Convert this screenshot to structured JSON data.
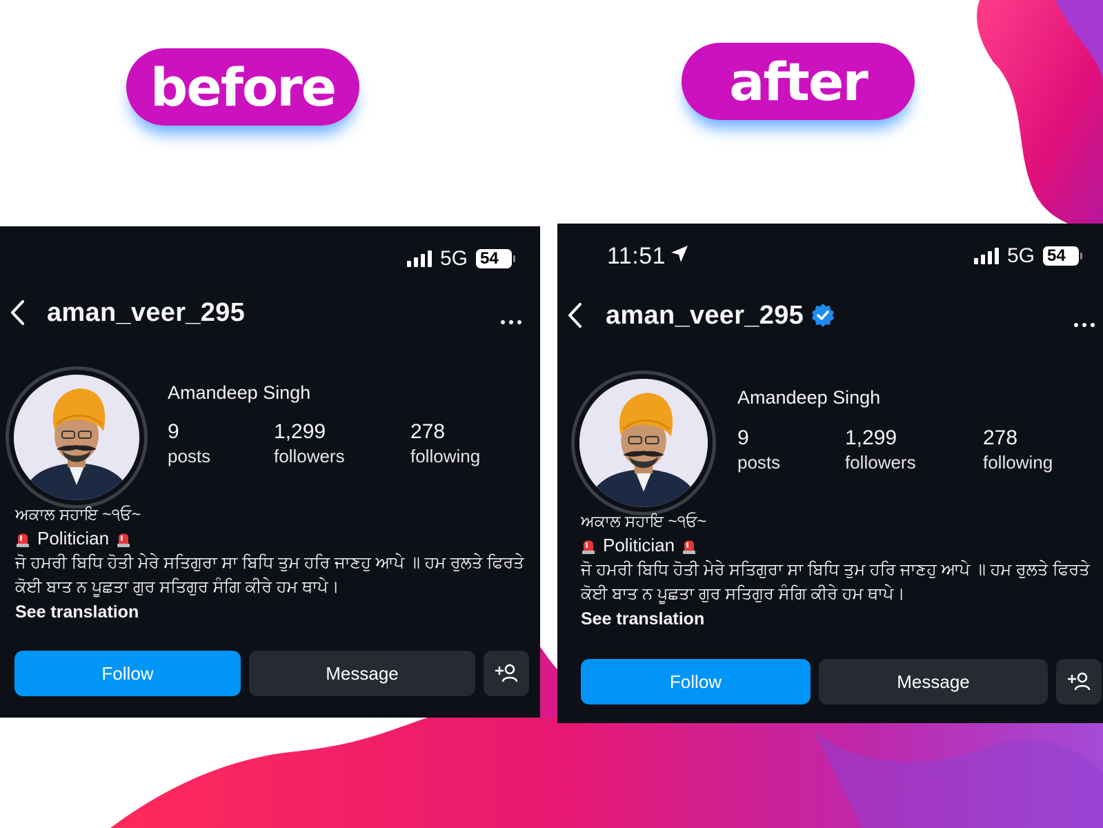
{
  "labels": {
    "before": "before",
    "after": "after"
  },
  "colors": {
    "pill": "#cc11bf",
    "screen_bg": "#0d1016",
    "follow": "#0095f6",
    "secondary_btn": "#262a31",
    "verified": "#1d8cf0"
  },
  "before": {
    "status": {
      "network": "5G",
      "battery": "54",
      "signal_icon": "signal-bars-icon"
    },
    "header": {
      "username": "aman_veer_295",
      "back_icon": "chevron-left-icon",
      "more_icon": "more-dots-icon"
    },
    "profile": {
      "name": "Amandeep Singh",
      "stats": [
        {
          "num": "9",
          "label": "posts"
        },
        {
          "num": "1,299",
          "label": "followers"
        },
        {
          "num": "278",
          "label": "following"
        }
      ]
    },
    "bio": {
      "tagline": "ਅਕਾਲ ਸਹਾਇ ~੧ਓ~",
      "role": "Politician",
      "line1": "ਜੋ ਹਮਰੀ ਬਿਧਿ ਹੋਤੀ ਮੇਰੇ ਸਤਿਗੁਰਾ ਸਾ ਬਿਧਿ ਤੁਮ ਹਰਿ ਜਾਣਹੁ ਆਪੇ ॥ ਹਮ ਰੁਲਤੇ ਫਿਰਤੇ",
      "line2": "ਕੋਈ ਬਾਤ ਨ ਪੂਛਤਾ ਗੁਰ ਸਤਿਗੁਰ ਸੰਗਿ ਕੀਰੇ ਹਮ ਥਾਪੇ।",
      "see_translation": "See translation"
    },
    "buttons": {
      "follow": "Follow",
      "message": "Message",
      "add_icon": "add-person-icon"
    }
  },
  "after": {
    "status": {
      "time": "11:51",
      "network": "5G",
      "battery": "54",
      "location_icon": "location-arrow-icon",
      "signal_icon": "signal-bars-icon"
    },
    "header": {
      "username": "aman_veer_295",
      "verified_icon": "verified-badge-icon",
      "back_icon": "chevron-left-icon",
      "more_icon": "more-dots-icon"
    },
    "profile": {
      "name": "Amandeep Singh",
      "stats": [
        {
          "num": "9",
          "label": "posts"
        },
        {
          "num": "1,299",
          "label": "followers"
        },
        {
          "num": "278",
          "label": "following"
        }
      ]
    },
    "bio": {
      "tagline": "ਅਕਾਲ ਸਹਾਇ ~੧ਓ~",
      "role": "Politician",
      "line1": "ਜੋ ਹਮਰੀ ਬਿਧਿ ਹੋਤੀ ਮੇਰੇ ਸਤਿਗੁਰਾ ਸਾ ਬਿਧਿ ਤੁਮ ਹਰਿ ਜਾਣਹੁ ਆਪੇ ॥ ਹਮ ਰੁਲਤੇ ਫਿਰਤੇ",
      "line2": "ਕੋਈ ਬਾਤ ਨ ਪੂਛਤਾ ਗੁਰ ਸਤਿਗੁਰ ਸੰਗਿ ਕੀਰੇ ਹਮ ਥਾਪੇ।",
      "see_translation": "See translation"
    },
    "buttons": {
      "follow": "Follow",
      "message": "Message",
      "add_icon": "add-person-icon"
    }
  }
}
